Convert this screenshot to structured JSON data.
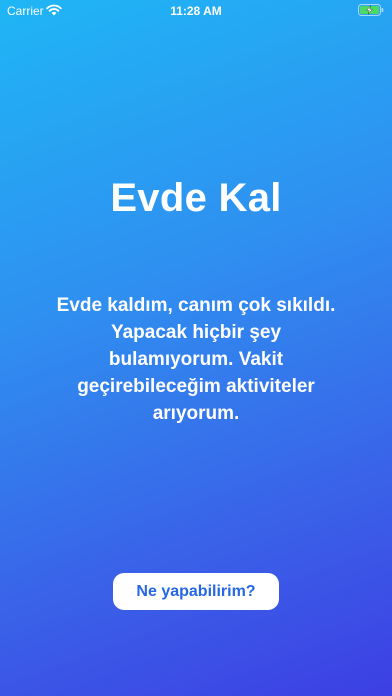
{
  "status_bar": {
    "carrier": "Carrier",
    "time": "11:28 AM",
    "wifi_icon": "wifi-icon",
    "battery_icon": "battery-charging-icon"
  },
  "main": {
    "title": "Evde Kal",
    "description": "Evde kaldım, canım çok sıkıldı. Yapacak hiçbir şey bulamıyorum. Vakit geçirebileceğim aktiviteler arıyorum.",
    "action_button_label": "Ne yapabilirim?"
  },
  "colors": {
    "gradient_start": "#1fb6f5",
    "gradient_end": "#3d3fe3",
    "button_background": "#ffffff",
    "button_text": "#2667e6",
    "text": "#ffffff"
  }
}
